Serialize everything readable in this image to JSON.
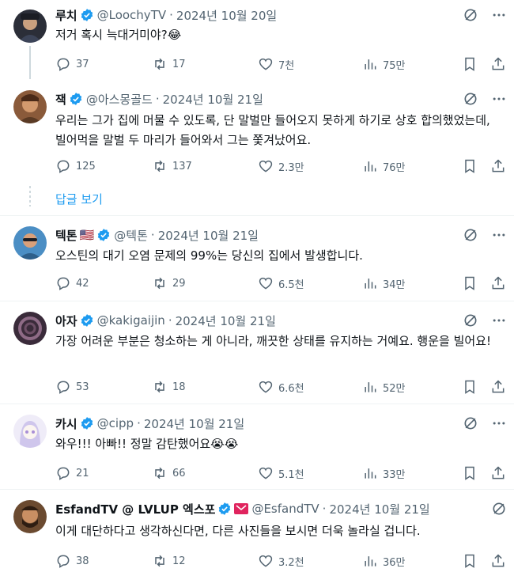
{
  "tweets": [
    {
      "name": "루치",
      "handle": "@LoochyTV",
      "date": "2024년 10월 20일",
      "text": "저거 혹시 늑대거미야?😂",
      "replies": "37",
      "retweets": "17",
      "likes": "7천",
      "views": "75만",
      "avatar_colors": [
        "#2b2e38",
        "#c9a07f"
      ]
    },
    {
      "name": "잭",
      "handle": "@아스몽골드",
      "date": "2024년 10월 21일",
      "text": "우리는 그가 집에 머물 수 있도록, 단 말벌만 들어오지 못하게 하기로 상호 합의했었는데, 빌어먹을 말벌 두 마리가 들어와서 그는 쫓겨났어요.",
      "replies": "125",
      "retweets": "137",
      "likes": "2.3만",
      "views": "76만",
      "avatar_colors": [
        "#7a4a2c",
        "#d39a6e"
      ]
    },
    {
      "name": "텍톤",
      "flag": "🇺🇸",
      "handle": "@텍톤",
      "date": "2024년 10월 21일",
      "text": "오스틴의 대기 오염 문제의 99%는 당신의 집에서 발생합니다.",
      "replies": "42",
      "retweets": "29",
      "likes": "6.5천",
      "views": "34만",
      "avatar_colors": [
        "#4b8ec4",
        "#d9a07a"
      ]
    },
    {
      "name": "아자",
      "handle": "@kakigaijin",
      "date": "2024년 10월 21일",
      "text": "가장 어려운 부분은 청소하는 게 아니라, 깨끗한 상태를 유지하는 거예요. 행운을 빌어요!",
      "replies": "53",
      "retweets": "18",
      "likes": "6.6천",
      "views": "52만",
      "avatar_colors": [
        "#3a2b3a",
        "#8e6b86"
      ]
    },
    {
      "name": "카시",
      "handle": "@cipp",
      "date": "2024년 10월 21일",
      "text": "와우!!! 아빠!! 정말 감탄했어요😭😭",
      "replies": "21",
      "retweets": "66",
      "likes": "5.1천",
      "views": "33만",
      "avatar_colors": [
        "#e8e4f4",
        "#a98fd6"
      ]
    },
    {
      "name": "EsfandTV @ LVLUP 엑스포",
      "handle": "@EsfandTV",
      "date": "2024년 10월 21일",
      "text": "이게 대단하다고 생각하신다면, 다른 사진들을 보시면 더욱 놀라실 겁니다.",
      "replies": "38",
      "retweets": "12",
      "likes": "3.2천",
      "views": "36만",
      "avatar_colors": [
        "#5b3a22",
        "#c98f63"
      ]
    }
  ],
  "show_replies_label": "답글 보기",
  "separator_dot": "·",
  "colors": {
    "accent": "#1d9bf0",
    "text": "#0f1419",
    "secondary": "#536471",
    "divider": "#eff3f4",
    "extra_badge": "#e0245e"
  }
}
